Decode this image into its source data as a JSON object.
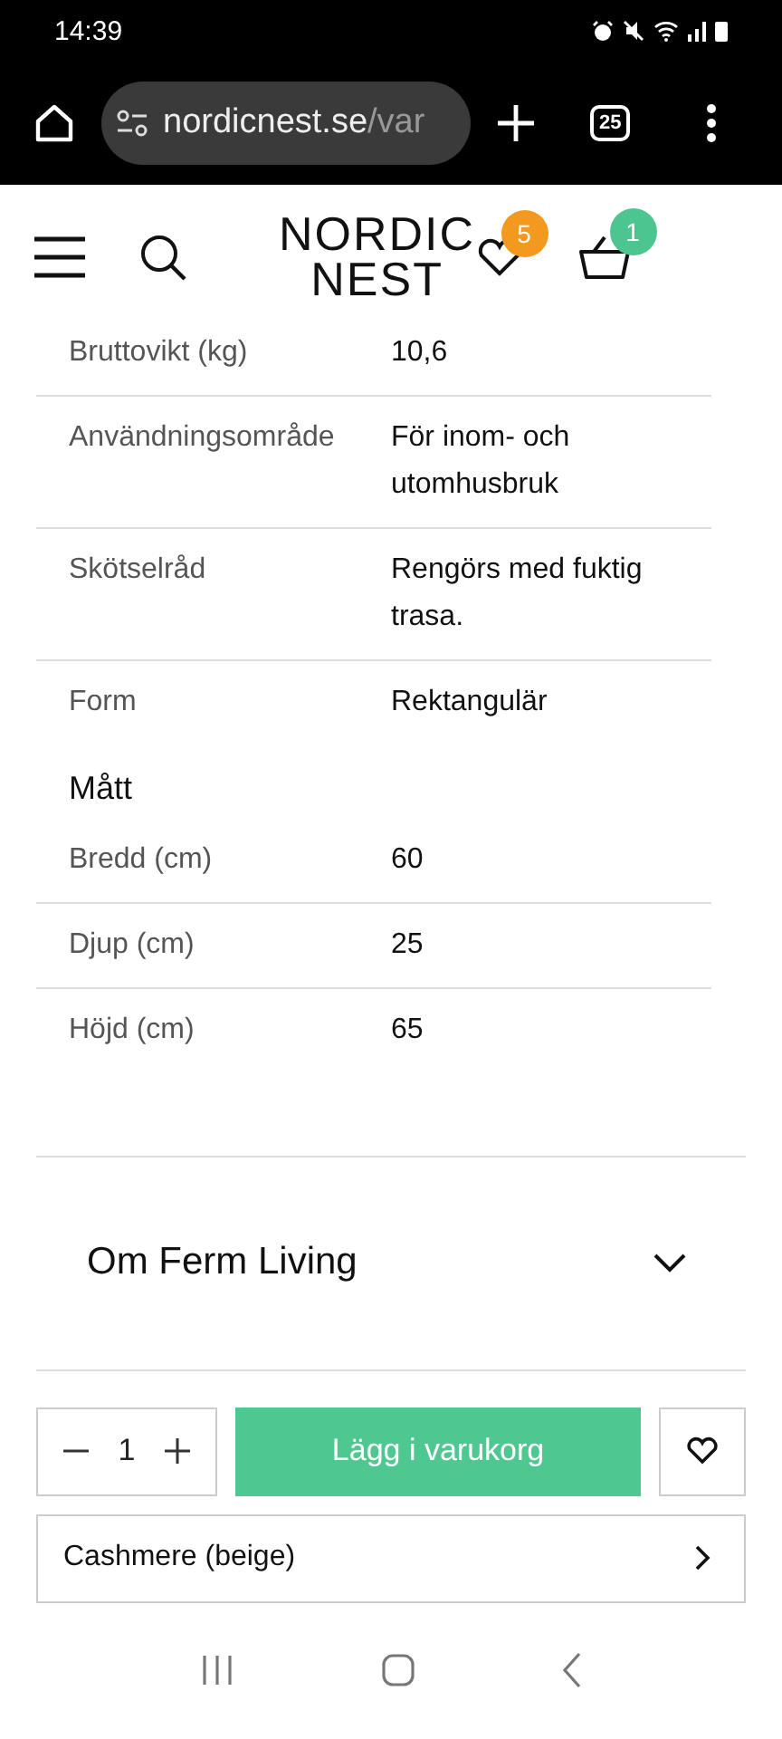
{
  "status_bar": {
    "time": "14:39"
  },
  "browser": {
    "url_host": "nordicnest.se",
    "url_path": "/var",
    "tab_count": "25"
  },
  "header": {
    "logo_line_1": "NORDIC",
    "logo_line_2": "NEST",
    "wishlist_count": "5",
    "cart_count": "1"
  },
  "specs": [
    {
      "label": "Bruttovikt (kg)",
      "value": "10,6"
    },
    {
      "label": "Användningsområde",
      "value": "För inom- och utomhusbruk"
    },
    {
      "label": "Skötselråd",
      "value": "Rengörs med fuktig trasa."
    },
    {
      "label": "Form",
      "value": "Rektangulär"
    }
  ],
  "dimensions": {
    "heading": "Mått",
    "rows": [
      {
        "label": "Bredd (cm)",
        "value": "60"
      },
      {
        "label": "Djup (cm)",
        "value": "25"
      },
      {
        "label": "Höjd (cm)",
        "value": "65"
      }
    ]
  },
  "accordion": {
    "title": "Om Ferm Living",
    "expanded": false
  },
  "purchase": {
    "quantity": "1",
    "add_button": "Lägg i varukorg",
    "variant": "Cashmere (beige)"
  }
}
